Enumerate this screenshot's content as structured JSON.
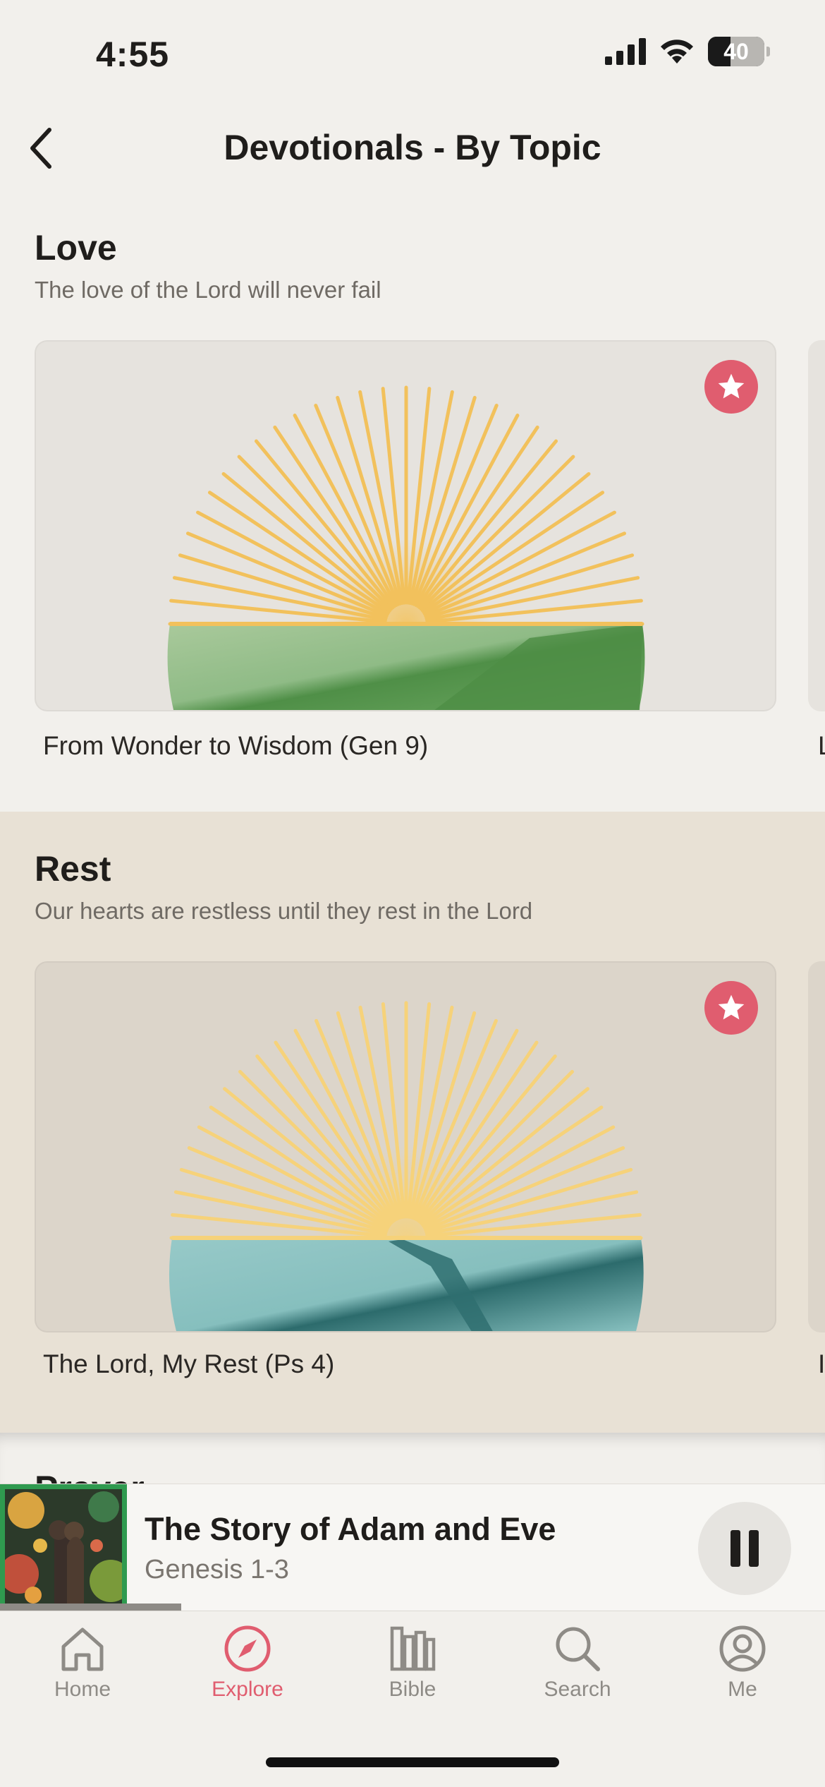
{
  "status_bar": {
    "time": "4:55",
    "battery": "40",
    "battery_level": 0.4
  },
  "header": {
    "title": "Devotionals - By Topic"
  },
  "sections": [
    {
      "title": "Love",
      "subtitle": "The love of the Lord will never fail",
      "card": {
        "label": "From Wonder to Wisdom (Gen 9)",
        "peek_label": "L"
      }
    },
    {
      "title": "Rest",
      "subtitle": "Our hearts are restless until they rest in the Lord",
      "card": {
        "label": "The Lord, My Rest (Ps 4)",
        "peek_label": "I"
      }
    },
    {
      "title": "Prayer"
    }
  ],
  "now_playing": {
    "title": "The Story of Adam and Eve",
    "subtitle": "Genesis 1-3",
    "progress": 0.22
  },
  "tabs": [
    {
      "label": "Home",
      "icon": "house-icon"
    },
    {
      "label": "Explore",
      "icon": "compass-icon",
      "active": true
    },
    {
      "label": "Bible",
      "icon": "books-icon"
    },
    {
      "label": "Search",
      "icon": "magnifier-icon"
    },
    {
      "label": "Me",
      "icon": "person-circle-icon"
    }
  ],
  "colors": {
    "accent": "#e05d6f",
    "background": "#f2f0ec",
    "rest_band": "#e8e1d5"
  }
}
